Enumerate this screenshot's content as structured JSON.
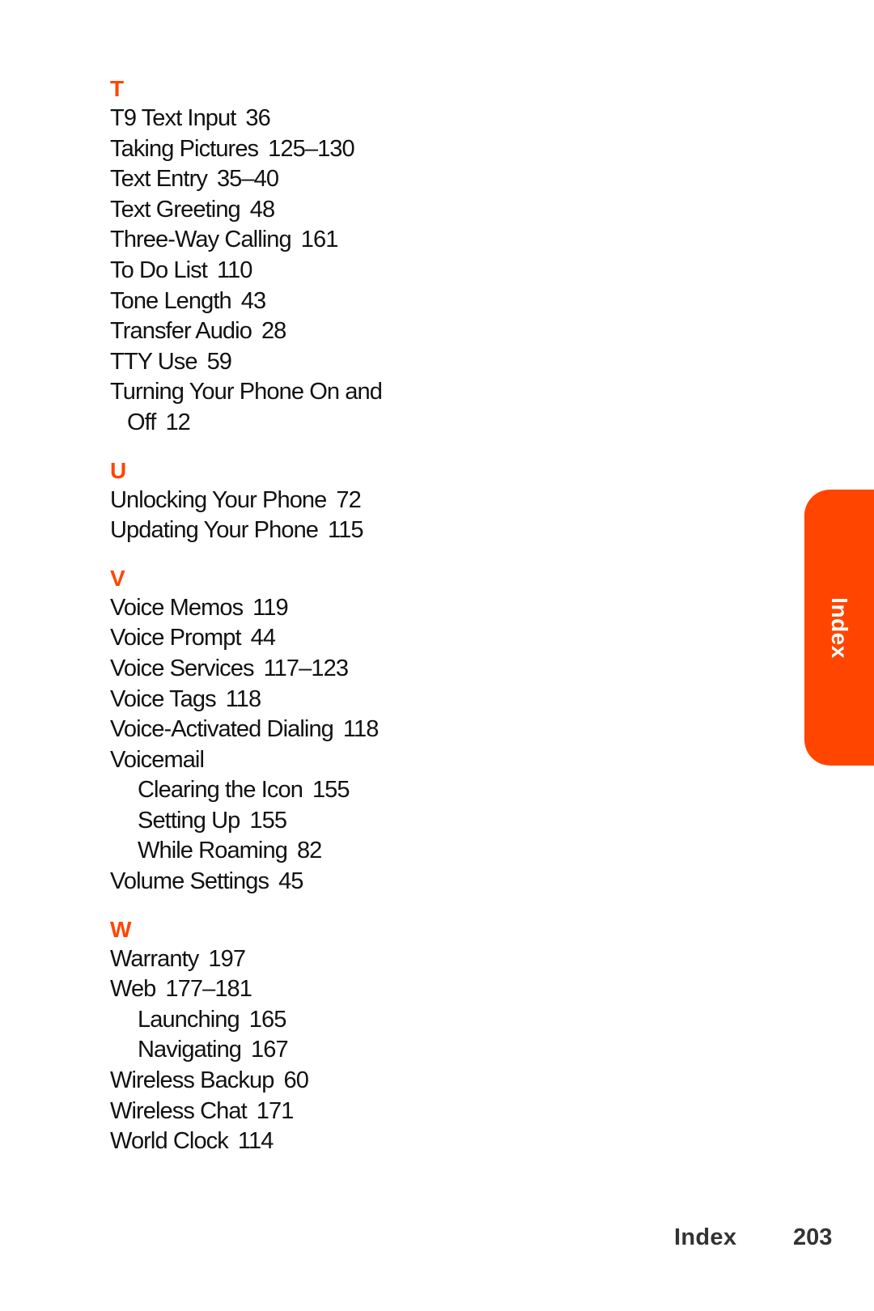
{
  "accent_color": "#ff4500",
  "sections": [
    {
      "letter": "T",
      "entries": [
        {
          "term": "T9 Text Input",
          "pages": "36"
        },
        {
          "term": "Taking Pictures",
          "pages": "125–130"
        },
        {
          "term": "Text Entry",
          "pages": "35–40"
        },
        {
          "term": "Text Greeting",
          "pages": "48"
        },
        {
          "term": "Three-Way Calling",
          "pages": "161"
        },
        {
          "term": "To Do List",
          "pages": "110"
        },
        {
          "term": "Tone Length",
          "pages": "43"
        },
        {
          "term": "Transfer Audio",
          "pages": "28"
        },
        {
          "term": "TTY Use",
          "pages": "59"
        },
        {
          "term": "Turning Your Phone On and",
          "continuation": "Off",
          "pages": "12"
        }
      ]
    },
    {
      "letter": "U",
      "entries": [
        {
          "term": "Unlocking Your Phone",
          "pages": "72"
        },
        {
          "term": "Updating Your Phone",
          "pages": "115"
        }
      ]
    },
    {
      "letter": "V",
      "entries": [
        {
          "term": "Voice Memos",
          "pages": "119"
        },
        {
          "term": "Voice Prompt",
          "pages": "44"
        },
        {
          "term": "Voice Services",
          "pages": "117–123"
        },
        {
          "term": "Voice Tags",
          "pages": "118"
        },
        {
          "term": "Voice-Activated Dialing",
          "pages": "118"
        },
        {
          "term": "Voicemail",
          "pages": ""
        },
        {
          "term": "Clearing the Icon",
          "pages": "155",
          "sub": true
        },
        {
          "term": "Setting Up",
          "pages": "155",
          "sub": true
        },
        {
          "term": "While Roaming",
          "pages": "82",
          "sub": true
        },
        {
          "term": "Volume Settings",
          "pages": "45"
        }
      ]
    },
    {
      "letter": "W",
      "entries": [
        {
          "term": "Warranty",
          "pages": "197"
        },
        {
          "term": "Web",
          "pages": "177–181"
        },
        {
          "term": "Launching",
          "pages": "165",
          "sub": true
        },
        {
          "term": "Navigating",
          "pages": "167",
          "sub": true
        },
        {
          "term": "Wireless Backup",
          "pages": "60"
        },
        {
          "term": "Wireless Chat",
          "pages": "171"
        },
        {
          "term": "World Clock",
          "pages": "114"
        }
      ]
    }
  ],
  "side_tab": {
    "label": "Index"
  },
  "footer": {
    "section": "Index",
    "page_number": "203"
  }
}
